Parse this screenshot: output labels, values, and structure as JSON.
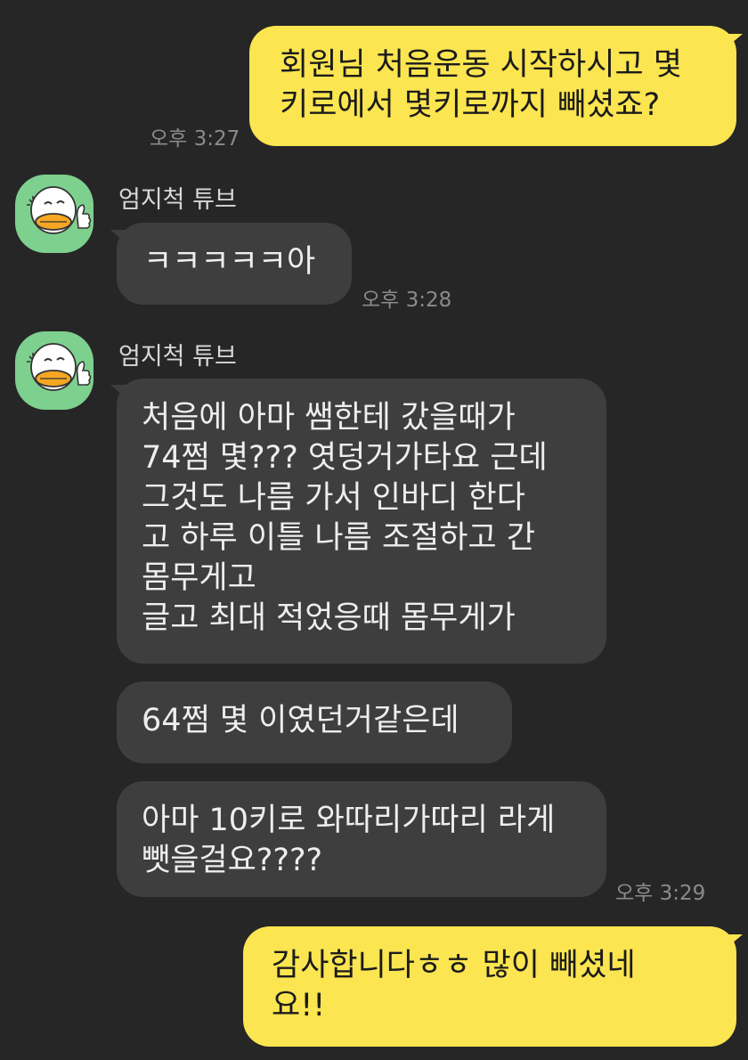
{
  "chat": {
    "messages": [
      {
        "direction": "out",
        "text": "회원님 처음운동 시작하시고 몇\n키로에서 몇키로까지 빼셨죠?",
        "time": "오후 3:27"
      },
      {
        "direction": "in",
        "sender": "엄지척 튜브",
        "text": "ㅋㅋㅋㅋㅋ아",
        "time": "오후 3:28"
      },
      {
        "direction": "in",
        "sender": "엄지척 튜브",
        "text": "처음에 아마 쌤한테 갔을때가\n74쩜 몇??? 엿덩거가타요 근데\n그것도 나름 가서 인바디 한다\n고 하루 이틀 나름 조절하고 간\n몸무게고\n글고 최대 적었응때 몸무게가"
      },
      {
        "direction": "in",
        "text": "64쩜 몇 이였던거같은데"
      },
      {
        "direction": "in",
        "text": "아마 10키로 와따리가따리 라게\n뺏을걸요????",
        "time": "오후 3:29"
      },
      {
        "direction": "out",
        "text": "감사합니다ㅎㅎ 많이 빼셨네\n요!!"
      }
    ]
  },
  "avatar": {
    "icon": "thumbs-up-character-icon",
    "background": "#7ed08f"
  },
  "colors": {
    "background": "#262626",
    "outgoing_bubble": "#fbe550",
    "incoming_bubble": "#3e3e3e",
    "timestamp": "#8b8b8b"
  }
}
